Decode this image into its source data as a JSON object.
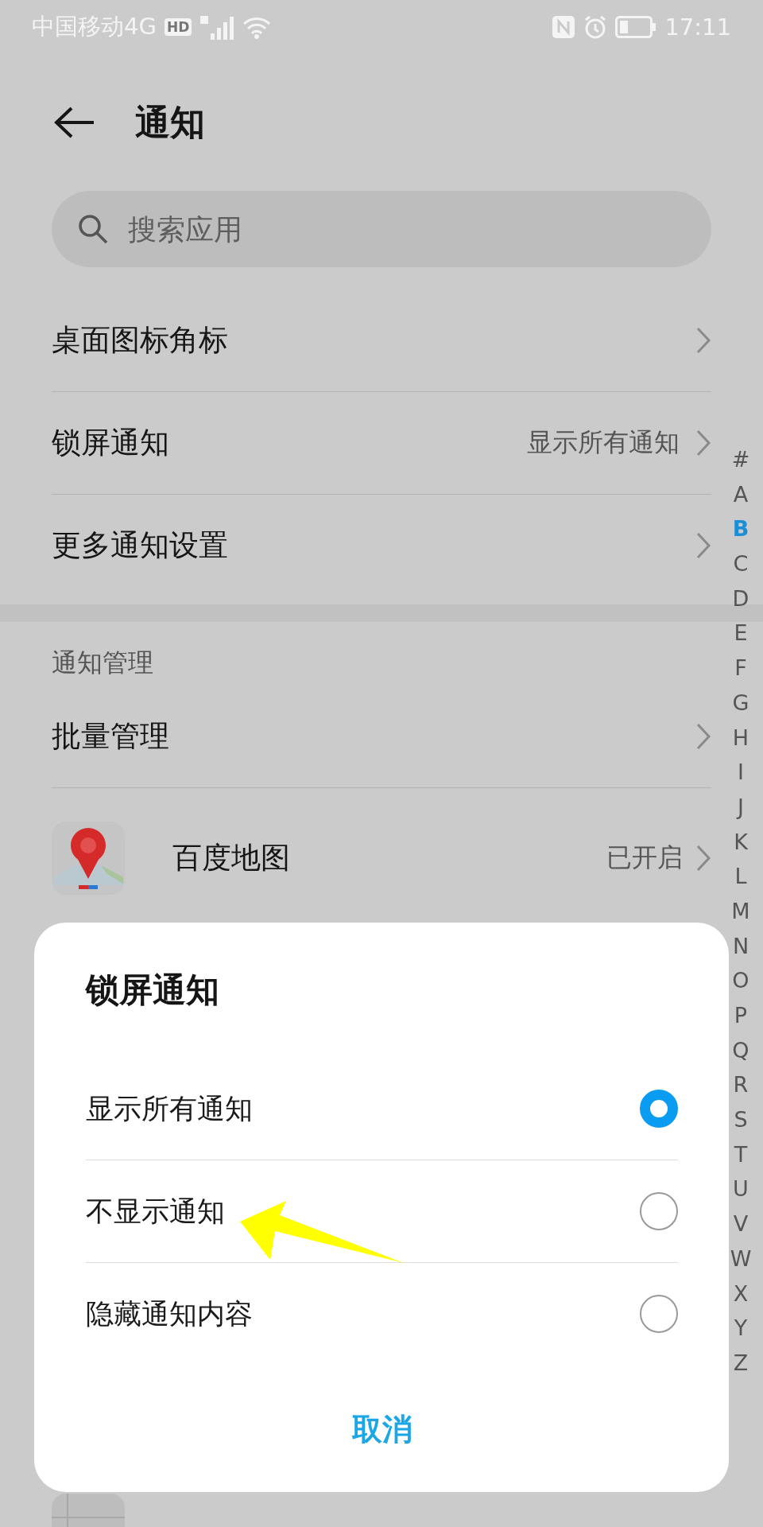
{
  "status_bar": {
    "carrier": "中国移动4G",
    "network_badge": "HD",
    "time": "17:11"
  },
  "header": {
    "title": "通知"
  },
  "search": {
    "placeholder": "搜索应用"
  },
  "settings": [
    {
      "label": "桌面图标角标"
    },
    {
      "label": "锁屏通知",
      "value": "显示所有通知"
    },
    {
      "label": "更多通知设置"
    }
  ],
  "section_title": "通知管理",
  "manage": [
    {
      "kind": "plain",
      "label": "批量管理"
    },
    {
      "kind": "map_app",
      "label": "百度地图",
      "value": "已开启"
    },
    {
      "kind": "notes_app"
    }
  ],
  "index_letters": [
    {
      "label": "#",
      "selected": false
    },
    {
      "label": "A",
      "selected": false
    },
    {
      "label": "B",
      "selected": true
    },
    {
      "label": "C",
      "selected": false
    },
    {
      "label": "D",
      "selected": false
    },
    {
      "label": "E",
      "selected": false
    },
    {
      "label": "F",
      "selected": false
    },
    {
      "label": "G",
      "selected": false
    },
    {
      "label": "H",
      "selected": false
    },
    {
      "label": "I",
      "selected": false
    },
    {
      "label": "J",
      "selected": false
    },
    {
      "label": "K",
      "selected": false
    },
    {
      "label": "L",
      "selected": false
    },
    {
      "label": "M",
      "selected": false
    },
    {
      "label": "N",
      "selected": false
    },
    {
      "label": "O",
      "selected": false
    },
    {
      "label": "P",
      "selected": false
    },
    {
      "label": "Q",
      "selected": false
    },
    {
      "label": "R",
      "selected": false
    },
    {
      "label": "S",
      "selected": false
    },
    {
      "label": "T",
      "selected": false
    },
    {
      "label": "U",
      "selected": false
    },
    {
      "label": "V",
      "selected": false
    },
    {
      "label": "W",
      "selected": false
    },
    {
      "label": "X",
      "selected": false
    },
    {
      "label": "Y",
      "selected": false
    },
    {
      "label": "Z",
      "selected": false
    }
  ],
  "dialog": {
    "title": "锁屏通知",
    "options": [
      {
        "label": "显示所有通知",
        "selected": true
      },
      {
        "label": "不显示通知",
        "selected": false
      },
      {
        "label": "隐藏通知内容",
        "selected": false
      }
    ],
    "cancel": "取消"
  },
  "annotation": {
    "kind": "arrow"
  }
}
